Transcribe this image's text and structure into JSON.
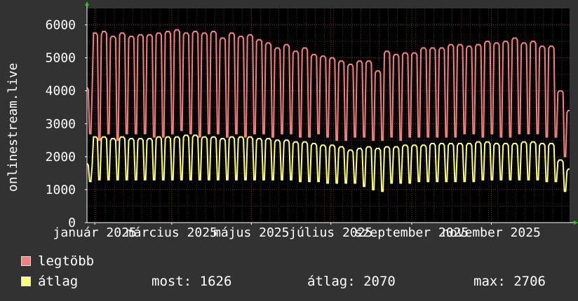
{
  "chart_data": {
    "type": "line",
    "ylabel": "onlinestream.live",
    "ylim": [
      0,
      6500
    ],
    "y_ticks": [
      0,
      1000,
      2000,
      3000,
      4000,
      5000,
      6000
    ],
    "x_tick_labels": [
      "január 2025",
      "március 2025",
      "május 2025",
      "július 2025",
      "szeptember 2025",
      "november 2025"
    ],
    "grid": true,
    "series": [
      {
        "name": "legtöbb",
        "color": "#f77f7f",
        "x": [
          "2024-12-26",
          "2024-12-31",
          "2025-01-07",
          "2025-01-13",
          "2025-01-20",
          "2025-01-27",
          "2025-02-03",
          "2025-02-10",
          "2025-02-17",
          "2025-02-24",
          "2025-03-03",
          "2025-03-10",
          "2025-03-17",
          "2025-03-24",
          "2025-03-31",
          "2025-04-07",
          "2025-04-14",
          "2025-04-21",
          "2025-04-28",
          "2025-05-05",
          "2025-05-12",
          "2025-05-19",
          "2025-05-26",
          "2025-06-02",
          "2025-06-09",
          "2025-06-16",
          "2025-06-23",
          "2025-06-30",
          "2025-07-07",
          "2025-07-14",
          "2025-07-21",
          "2025-07-28",
          "2025-08-04",
          "2025-08-11",
          "2025-08-18",
          "2025-08-25",
          "2025-09-01",
          "2025-09-08",
          "2025-09-15",
          "2025-09-22",
          "2025-09-29",
          "2025-10-06",
          "2025-10-13",
          "2025-10-20",
          "2025-10-27",
          "2025-11-03",
          "2025-11-10",
          "2025-11-17",
          "2025-11-24",
          "2025-12-01",
          "2025-12-08",
          "2025-12-15",
          "2025-12-22",
          "2025-12-29"
        ],
        "peak": [
          4100,
          5750,
          5800,
          5650,
          5750,
          5650,
          5700,
          5700,
          5750,
          5800,
          5850,
          5750,
          5800,
          5750,
          5800,
          5600,
          5750,
          5650,
          5700,
          5550,
          5450,
          5300,
          5400,
          5200,
          5300,
          5100,
          5050,
          5000,
          4900,
          4800,
          4900,
          4900,
          4600,
          5200,
          5100,
          5150,
          5150,
          5300,
          5300,
          5300,
          5400,
          5400,
          5350,
          5400,
          5500,
          5450,
          5500,
          5600,
          5450,
          5500,
          5350,
          5350,
          4000,
          3400
        ],
        "low": [
          2700,
          2500,
          2700,
          2500,
          2700,
          2700,
          2700,
          2600,
          2600,
          2700,
          2800,
          2700,
          2600,
          2700,
          2700,
          2600,
          2700,
          2600,
          2700,
          2700,
          2600,
          2700,
          2700,
          2600,
          2600,
          2700,
          2600,
          2500,
          2500,
          2600,
          2600,
          2500,
          2500,
          2600,
          2500,
          2600,
          2600,
          2600,
          2600,
          2600,
          2600,
          2700,
          2700,
          2600,
          2700,
          2600,
          2600,
          2700,
          2700,
          2700,
          2600,
          2600,
          2000,
          2000
        ]
      },
      {
        "name": "átlag",
        "color": "#ffff77",
        "x": [
          "2024-12-26",
          "2024-12-31",
          "2025-01-07",
          "2025-01-13",
          "2025-01-20",
          "2025-01-27",
          "2025-02-03",
          "2025-02-10",
          "2025-02-17",
          "2025-02-24",
          "2025-03-03",
          "2025-03-10",
          "2025-03-17",
          "2025-03-24",
          "2025-03-31",
          "2025-04-07",
          "2025-04-14",
          "2025-04-21",
          "2025-04-28",
          "2025-05-05",
          "2025-05-12",
          "2025-05-19",
          "2025-05-26",
          "2025-06-02",
          "2025-06-09",
          "2025-06-16",
          "2025-06-23",
          "2025-06-30",
          "2025-07-07",
          "2025-07-14",
          "2025-07-21",
          "2025-07-28",
          "2025-08-04",
          "2025-08-11",
          "2025-08-18",
          "2025-08-25",
          "2025-09-01",
          "2025-09-08",
          "2025-09-15",
          "2025-09-22",
          "2025-09-29",
          "2025-10-06",
          "2025-10-13",
          "2025-10-20",
          "2025-10-27",
          "2025-11-03",
          "2025-11-10",
          "2025-11-17",
          "2025-11-24",
          "2025-12-01",
          "2025-12-08",
          "2025-12-15",
          "2025-12-22",
          "2025-12-29"
        ],
        "peak": [
          1800,
          2600,
          2600,
          2550,
          2600,
          2550,
          2550,
          2550,
          2600,
          2600,
          2600,
          2650,
          2650,
          2600,
          2600,
          2550,
          2600,
          2600,
          2600,
          2550,
          2550,
          2500,
          2500,
          2450,
          2450,
          2400,
          2350,
          2350,
          2300,
          2200,
          2250,
          2300,
          2250,
          2300,
          2300,
          2350,
          2350,
          2350,
          2400,
          2400,
          2400,
          2400,
          2400,
          2450,
          2450,
          2400,
          2400,
          2400,
          2450,
          2450,
          2400,
          2400,
          1900,
          1626
        ],
        "low": [
          1250,
          1300,
          1300,
          1300,
          1300,
          1300,
          1300,
          1300,
          1300,
          1300,
          1300,
          1300,
          1300,
          1300,
          1300,
          1300,
          1300,
          1300,
          1300,
          1300,
          1300,
          1300,
          1300,
          1250,
          1250,
          1250,
          1200,
          1200,
          1200,
          1200,
          1100,
          1000,
          950,
          1200,
          1200,
          1200,
          1250,
          1250,
          1250,
          1250,
          1250,
          1250,
          1250,
          1300,
          1300,
          1300,
          1300,
          1300,
          1300,
          1300,
          1250,
          1250,
          950,
          1050
        ]
      }
    ]
  },
  "legend": {
    "max_label": "legtöbb",
    "avg_label": "átlag",
    "max_color": "#f77f7f",
    "avg_color": "#ffff77"
  },
  "stats": {
    "now": "most: 1626",
    "avg": "átlag: 2070",
    "max": "max: 2706"
  }
}
